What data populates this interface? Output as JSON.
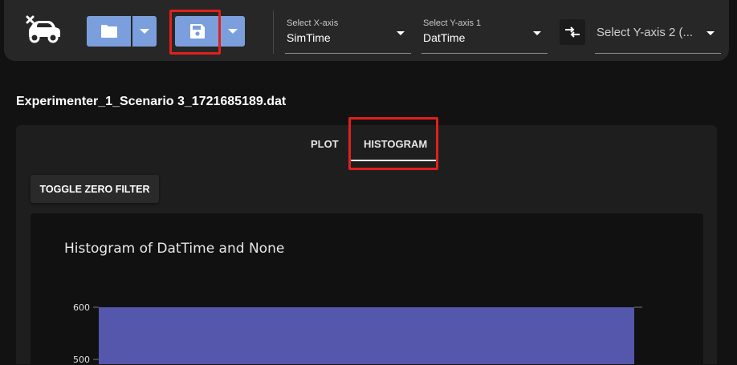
{
  "toolbar": {
    "car_icon": "car-icon",
    "open_icon": "folder-icon",
    "save_icon": "save-disk-icon",
    "dropdown_icon": "caret-down-icon",
    "swap_icon": "swap-axes-icon",
    "button_color": "#7b9fdc",
    "highlight_color": "#e0201c",
    "x_axis": {
      "label": "Select X-axis",
      "value": "SimTime"
    },
    "y_axis_1": {
      "label": "Select Y-axis 1",
      "value": "DatTime"
    },
    "y_axis_2": {
      "placeholder": "Select Y-axis 2 (..."
    }
  },
  "file_title": "Experimenter_1_Scenario 3_1721685189.dat",
  "tabs": [
    {
      "label": "PLOT",
      "active": false
    },
    {
      "label": "HISTOGRAM",
      "active": true
    }
  ],
  "toggle_button": "TOGGLE ZERO FILTER",
  "chart_data": {
    "type": "bar",
    "title": "Histogram of DatTime and None",
    "bar_color": "#5457ab",
    "y_ticks": [
      600,
      500
    ],
    "ylim_visible": [
      490,
      620
    ],
    "values": [
      600
    ],
    "grid": false
  }
}
